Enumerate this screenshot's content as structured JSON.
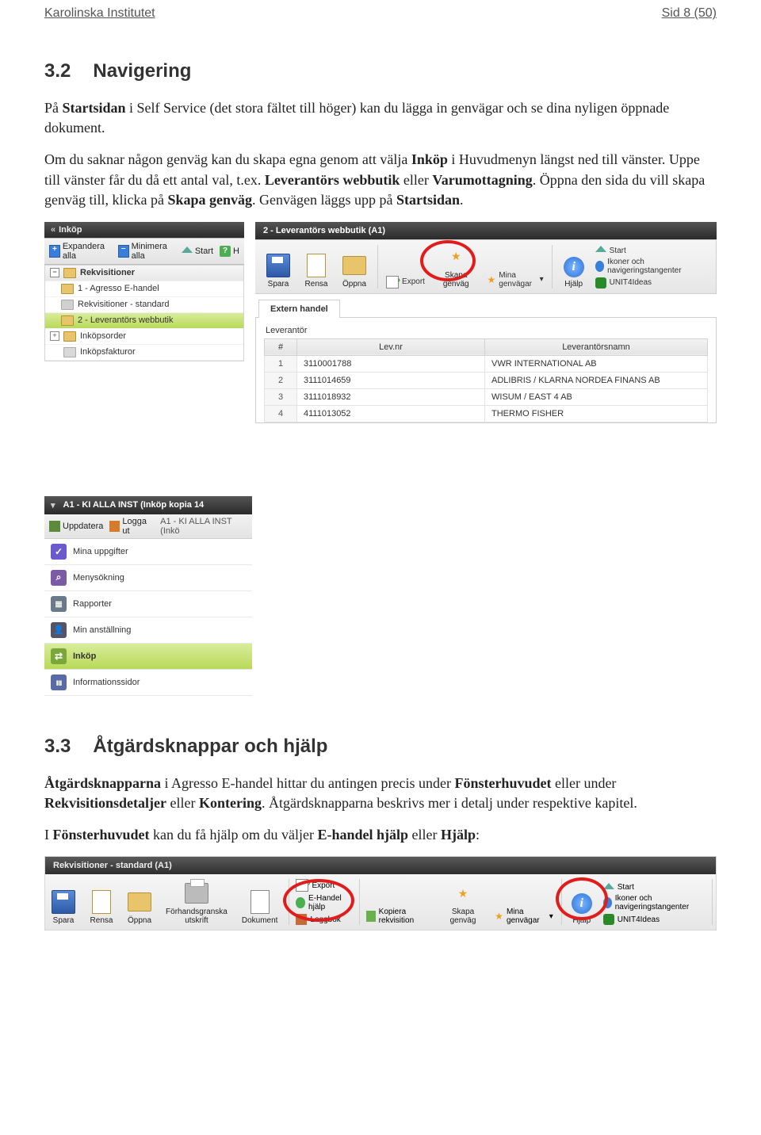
{
  "header": {
    "left": "Karolinska Institutet",
    "right": "Sid 8 (50)"
  },
  "sec32": {
    "num": "3.2",
    "title": "Navigering",
    "p1a": "På ",
    "p1b": "Startsidan",
    "p1c": " i Self Service (det stora fältet till höger) kan du lägga in genvägar och se dina nyligen öppnade dokument.",
    "p2a": "Om du saknar någon genväg kan du skapa egna genom att välja ",
    "p2b": "Inköp",
    "p2c": " i Huvudmenyn längst ned till vänster. Uppe till vänster får du då ett antal val, t.ex. ",
    "p2d": "Leverantörs webbutik",
    "p2e": " eller ",
    "p2f": "Varumottagning",
    "p2g": ". Öppna den sida du vill skapa genväg till, klicka på ",
    "p2h": "Skapa genväg",
    "p2i": ". Genvägen läggs upp på ",
    "p2j": "Startsidan",
    "p2k": "."
  },
  "shot1": {
    "leftTitle": "Inköp",
    "toolbar": {
      "expand": "Expandera alla",
      "collapse": "Minimera alla",
      "start": "Start",
      "help": "H"
    },
    "tree": {
      "header": "Rekvisitioner",
      "items": [
        {
          "label": "1 - Agresso E-handel"
        },
        {
          "label": "Rekvisitioner - standard"
        },
        {
          "label": "2 - Leverantörs webbutik",
          "selected": true
        }
      ],
      "group2": "Inköpsorder",
      "group3": "Inköpsfakturor"
    },
    "mainTitle": "2 - Leverantörs webbutik (A1)",
    "ribbon": {
      "save": "Spara",
      "clear": "Rensa",
      "open": "Öppna",
      "export": "Export",
      "shortcut": "Skapa genväg",
      "myshortcuts": "Mina genvägar",
      "dd": "▾",
      "help": "Hjälp",
      "start": "Start",
      "keys": "Ikoner och navigeringstangenter",
      "unit4": "UNIT4Ideas"
    },
    "subtab": "Extern handel",
    "table": {
      "group": "Leverantör",
      "cols": {
        "idx": "#",
        "nr": "Lev.nr",
        "name": "Leverantörsnamn"
      },
      "rows": [
        {
          "i": "1",
          "nr": "3110001788",
          "name": "VWR INTERNATIONAL AB"
        },
        {
          "i": "2",
          "nr": "3111014659",
          "name": "ADLIBRIS / KLARNA NORDEA FINANS AB"
        },
        {
          "i": "3",
          "nr": "3111018932",
          "name": "WISUM / EAST 4 AB"
        },
        {
          "i": "4",
          "nr": "4111013052",
          "name": "THERMO FISHER"
        }
      ]
    },
    "side2": {
      "title": "A1 - KI ALLA INST (Inköp kopia 14",
      "tb": {
        "upd": "Uppdatera",
        "logout": "Logga ut",
        "path": "A1 - KI ALLA INST (Inkö"
      },
      "items": [
        {
          "label": "Mina uppgifter"
        },
        {
          "label": "Menysökning"
        },
        {
          "label": "Rapporter"
        },
        {
          "label": "Min anställning"
        },
        {
          "label": "Inköp",
          "selected": true
        },
        {
          "label": "Informationssidor"
        }
      ]
    }
  },
  "sec33": {
    "num": "3.3",
    "title": "Åtgärdsknappar och hjälp",
    "p1a": "Åtgärdsknapparna",
    "p1b": " i Agresso E-handel hittar du antingen precis under ",
    "p1c": "Fönsterhuvudet",
    "p1d": " eller under ",
    "p1e": "Rekvisitionsdetaljer",
    "p1f": " eller ",
    "p1g": "Kontering",
    "p1h": ". Åtgärdsknapparna beskrivs mer i detalj under respektive kapitel.",
    "p2a": "I ",
    "p2b": "Fönsterhuvudet",
    "p2c": " kan du få hjälp om du väljer ",
    "p2d": "E-handel hjälp",
    "p2e": " eller ",
    "p2f": "Hjälp",
    "p2g": ":"
  },
  "shot2": {
    "title": "Rekvisitioner - standard (A1)",
    "btns": {
      "save": "Spara",
      "clear": "Rensa",
      "open": "Öppna",
      "preview": "Förhandsgranska utskrift",
      "doc": "Dokument",
      "export": "Export",
      "ehelp": "E-Handel hjälp",
      "log": "Loggbok",
      "copy": "Kopiera rekvisition",
      "shortcut": "Skapa genväg",
      "myshortcuts": "Mina genvägar",
      "dd": "▾",
      "help": "Hjälp",
      "start": "Start",
      "keys": "Ikoner och navigeringstangenter",
      "unit4": "UNIT4Ideas"
    }
  }
}
